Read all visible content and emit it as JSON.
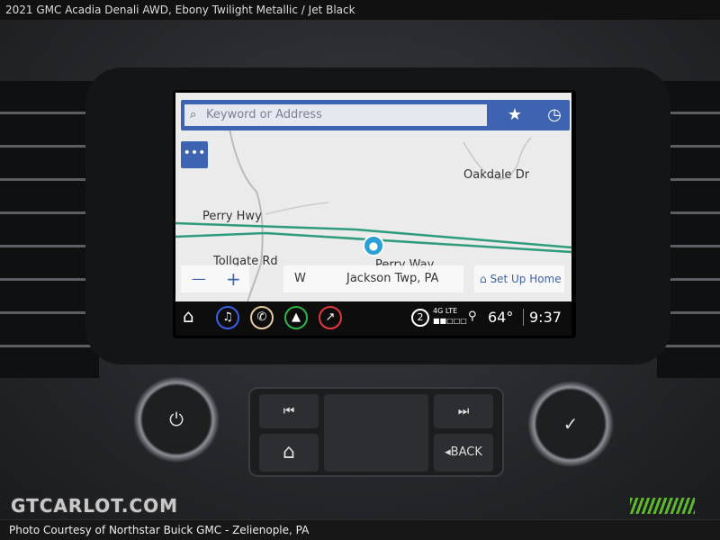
{
  "photo_title": "2021 GMC Acadia Denali AWD,  Ebony Twilight Metallic / Jet Black",
  "nav": {
    "search_placeholder": "Keyword or Address",
    "favorites_icon": "star-icon",
    "recent_icon": "clock-icon",
    "more_label": "•••",
    "streets": [
      "Oakdale Dr",
      "Perry Hwy",
      "Tollgate Rd",
      "Perry Way"
    ],
    "zoom_out": "—",
    "zoom_in": "+",
    "heading": "W",
    "location": "Jackson Twp, PA",
    "set_home": "Set Up Home",
    "route_color": "#2e9b7c",
    "accent": "#3e63b0"
  },
  "statusbar": {
    "apps": [
      {
        "name": "audio",
        "icon": "♫",
        "color": "#3a5ee0"
      },
      {
        "name": "phone",
        "icon": "✆",
        "color": "#e6c9a0"
      },
      {
        "name": "navigation",
        "icon": "▲",
        "color": "#2fb24a"
      },
      {
        "name": "onstar",
        "icon": "↗",
        "color": "#e03a3a"
      }
    ],
    "notifications": "2",
    "network": "4G LTE",
    "signal_bars": "■■□□□",
    "temperature": "64°",
    "time": "9:37"
  },
  "controls": {
    "back_label": "◂BACK",
    "power_icon": "⏻",
    "check_icon": "✓",
    "prev_icon": "⏮",
    "next_icon": "⏭",
    "home_icon": "⌂"
  },
  "watermark": "GTCARLOT.COM",
  "credit": "Photo Courtesy of Northstar Buick GMC - Zelienople, PA"
}
